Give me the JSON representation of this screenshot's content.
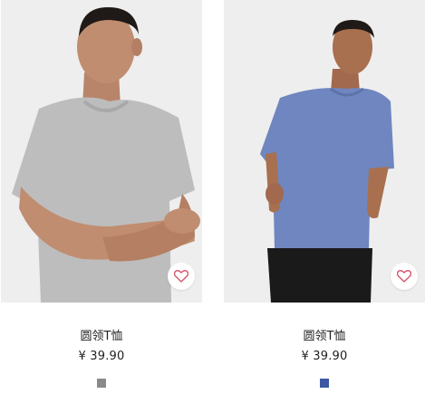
{
  "products": [
    {
      "name": "圆领T恤",
      "price": "¥ 39.90",
      "swatch_color": "#8a8a8a",
      "shirt_color": "#bdbdbd",
      "background_color": "#eeeeee"
    },
    {
      "name": "圆领T恤",
      "price": "¥ 39.90",
      "swatch_color": "#3d57a3",
      "shirt_color": "#6f86c0",
      "background_color": "#eeeeee"
    }
  ],
  "icons": {
    "favorite": "heart-outline-icon"
  },
  "colors": {
    "favorite_heart": "#d4566b"
  }
}
